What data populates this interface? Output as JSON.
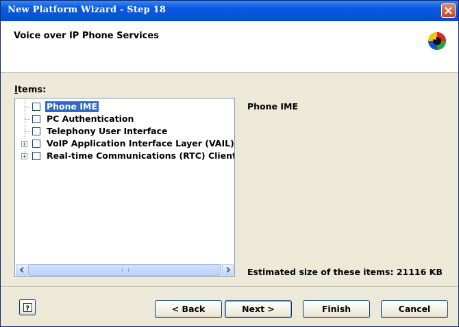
{
  "window": {
    "title": "New Platform Wizard - Step 18"
  },
  "header": {
    "title": "Voice over IP Phone Services"
  },
  "items_label": "Items:",
  "tree": {
    "items": [
      {
        "label": "Phone IME",
        "checked": false,
        "expandable": false,
        "selected": true
      },
      {
        "label": "PC Authentication",
        "checked": false,
        "expandable": false,
        "selected": false
      },
      {
        "label": "Telephony User Interface",
        "checked": false,
        "expandable": false,
        "selected": false
      },
      {
        "label": "VoIP Application Interface Layer (VAIL)",
        "checked": false,
        "expandable": true,
        "selected": false
      },
      {
        "label": "Real-time Communications (RTC) Client API",
        "checked": false,
        "expandable": true,
        "selected": false
      }
    ]
  },
  "description": {
    "title": "Phone IME"
  },
  "estimate": "Estimated size of these items: 21116 KB",
  "buttons": {
    "back": "< Back",
    "next": "Next >",
    "finish": "Finish",
    "cancel": "Cancel"
  },
  "icons": {
    "close": "close-icon",
    "logo": "wizard-logo-icon",
    "help": "help-icon"
  }
}
